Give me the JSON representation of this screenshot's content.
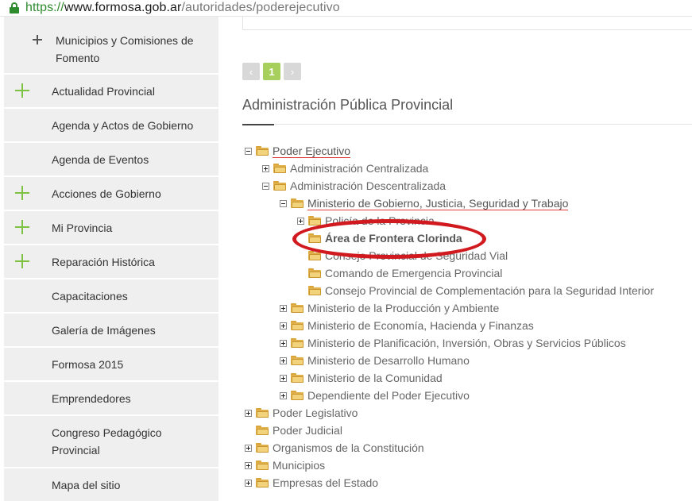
{
  "browser": {
    "url_scheme": "https://",
    "url_host": "www.formosa.gob.ar",
    "url_path": "/autoridades/poderejecutivo"
  },
  "sidebar": {
    "sub_item": {
      "label": "Municipios y Comisiones de Fomento"
    },
    "items": [
      {
        "label": "Actualidad Provincial",
        "expandable": true
      },
      {
        "label": "Agenda y Actos de Gobierno",
        "expandable": false
      },
      {
        "label": "Agenda de Eventos",
        "expandable": false
      },
      {
        "label": "Acciones de Gobierno",
        "expandable": true
      },
      {
        "label": "Mi Provincia",
        "expandable": true
      },
      {
        "label": "Reparación Histórica",
        "expandable": true
      },
      {
        "label": "Capacitaciones",
        "expandable": false
      },
      {
        "label": "Galería de Imágenes",
        "expandable": false
      },
      {
        "label": "Formosa 2015",
        "expandable": false
      },
      {
        "label": "Emprendedores",
        "expandable": false
      },
      {
        "label": "Congreso Pedagógico Provincial",
        "expandable": false
      },
      {
        "label": "Mapa del sitio",
        "expandable": false
      }
    ]
  },
  "pager": {
    "prev": "‹",
    "current": "1",
    "next": "›"
  },
  "section": {
    "title": "Administración Pública Provincial"
  },
  "tree": [
    {
      "label": "Poder Ejecutivo",
      "toggle": "minus",
      "style": "red"
    },
    {
      "label": "Administración Centralizada",
      "toggle": "plus"
    },
    {
      "label": "Administración Descentralizada",
      "toggle": "minus"
    },
    {
      "label": "Ministerio de Gobierno, Justicia, Seguridad y Trabajo",
      "toggle": "minus",
      "style": "red"
    },
    {
      "label": "Policía de la Provincia",
      "toggle": "plus"
    },
    {
      "label": "Área de Frontera Clorinda",
      "toggle": "none",
      "style": "bold"
    },
    {
      "label": "Consejo Provincial de Seguridad Vial",
      "toggle": "none"
    },
    {
      "label": "Comando de Emergencia Provincial",
      "toggle": "none"
    },
    {
      "label": "Consejo Provincial de Complementación para la Seguridad Interior",
      "toggle": "none"
    },
    {
      "label": "Ministerio de la Producción y Ambiente",
      "toggle": "plus"
    },
    {
      "label": "Ministerio de Economía, Hacienda y Finanzas",
      "toggle": "plus"
    },
    {
      "label": "Ministerio de Planificación, Inversión, Obras y Servicios Públicos",
      "toggle": "plus"
    },
    {
      "label": "Ministerio de Desarrollo Humano",
      "toggle": "plus"
    },
    {
      "label": "Ministerio de la Comunidad",
      "toggle": "plus"
    },
    {
      "label": "Dependiente del Poder Ejecutivo",
      "toggle": "plus"
    },
    {
      "label": "Poder Legislativo",
      "toggle": "plus"
    },
    {
      "label": "Poder Judicial",
      "toggle": "none"
    },
    {
      "label": "Organismos de la Constitución",
      "toggle": "plus"
    },
    {
      "label": "Municipios",
      "toggle": "plus"
    },
    {
      "label": "Empresas del Estado",
      "toggle": "plus"
    }
  ],
  "colors": {
    "accent_green": "#7dc242",
    "pager_green": "#a6cf5b",
    "annotation_red": "#d11a1f"
  }
}
